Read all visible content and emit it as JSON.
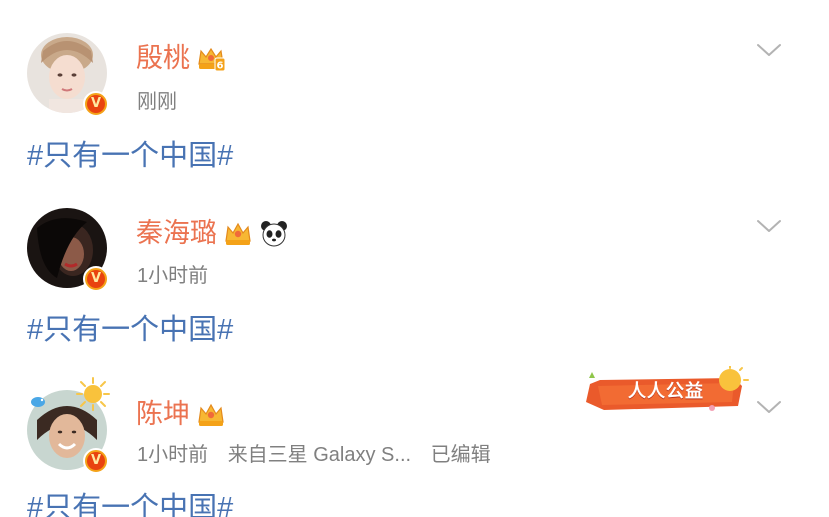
{
  "posts": [
    {
      "username": "殷桃",
      "time": "刚刚",
      "source": "",
      "edited": "",
      "text": "#只有一个中国#",
      "badge": "crown-6-icon",
      "extra_icon": ""
    },
    {
      "username": "秦海璐",
      "time": "1小时前",
      "source": "",
      "edited": "",
      "text": "#只有一个中国#",
      "badge": "crown-icon",
      "extra_icon": "panda-icon"
    },
    {
      "username": "陈坤",
      "time": "1小时前",
      "source": "来自三星 Galaxy S...",
      "edited": "已编辑",
      "text": "#只有一个中国#",
      "badge": "crown-icon",
      "extra_icon": "",
      "charity_label": "人人公益"
    }
  ],
  "verified_badge_letter": "V",
  "colors": {
    "username": "#eb7350",
    "meta": "#808080",
    "topic": "#4873b3",
    "verified_badge": "#e9430f"
  }
}
